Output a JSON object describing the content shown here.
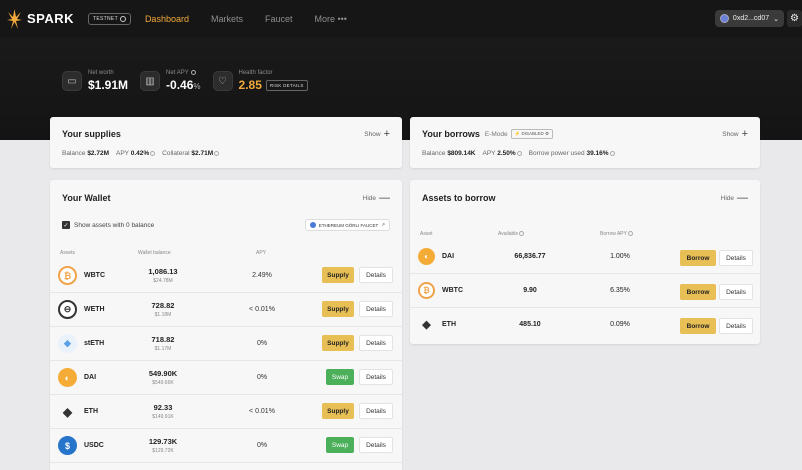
{
  "nav": {
    "logo": "SPARK",
    "testnet_label": "TESTNET",
    "items": [
      {
        "label": "Dashboard",
        "active": true
      },
      {
        "label": "Markets",
        "active": false
      },
      {
        "label": "Faucet",
        "active": false
      },
      {
        "label": "More •••",
        "active": false
      }
    ],
    "wallet_address": "0xd2...cd07"
  },
  "hero": {
    "net_worth_label": "Net worth",
    "net_worth_value": "$1.91M",
    "net_apy_label": "Net APY",
    "net_apy_value": "-0.46",
    "net_apy_unit": "%",
    "health_label": "Health factor",
    "health_value": "2.85",
    "risk_details_label": "RISK DETAILS"
  },
  "supplies": {
    "title": "Your supplies",
    "toggle_label": "Show",
    "balance_label": "Balance",
    "balance_value": "$2.72M",
    "apy_label": "APY",
    "apy_value": "0.42%",
    "collateral_label": "Collateral",
    "collateral_value": "$2.71M"
  },
  "borrows": {
    "title": "Your borrows",
    "emode_label": "E-Mode",
    "emode_badge": "DISABLED",
    "toggle_label": "Show",
    "balance_label": "Balance",
    "balance_value": "$809.14K",
    "apy_label": "APY",
    "apy_value": "2.50%",
    "power_label": "Borrow power used",
    "power_value": "39.16%"
  },
  "wallet": {
    "title": "Your Wallet",
    "toggle_label": "Hide",
    "checkbox_label": "Show assets with 0 balance",
    "faucet_label": "ETHEREUM GÖRLI FAUCET",
    "columns": [
      "Assets",
      "Wallet balance",
      "APY"
    ],
    "rows": [
      {
        "symbol": "WBTC",
        "amount": "1,086.13",
        "usd": "$24.78M",
        "apy": "2.49%",
        "action": "Supply",
        "details": "Details"
      },
      {
        "symbol": "WETH",
        "amount": "728.82",
        "usd": "$1.18M",
        "apy": "< 0.01%",
        "action": "Supply",
        "details": "Details"
      },
      {
        "symbol": "stETH",
        "amount": "718.82",
        "usd": "$1.17M",
        "apy": "0%",
        "action": "Supply",
        "details": "Details"
      },
      {
        "symbol": "DAI",
        "amount": "549.90K",
        "usd": "$549.66K",
        "apy": "0%",
        "action": "Swap",
        "details": "Details"
      },
      {
        "symbol": "ETH",
        "amount": "92.33",
        "usd": "$149.91K",
        "apy": "< 0.01%",
        "action": "Supply",
        "details": "Details"
      },
      {
        "symbol": "USDC",
        "amount": "129.73K",
        "usd": "$129.72K",
        "apy": "0%",
        "action": "Swap",
        "details": "Details"
      }
    ]
  },
  "borrow_assets": {
    "title": "Assets to borrow",
    "toggle_label": "Hide",
    "columns": [
      "Asset",
      "Available",
      "Borrow APY"
    ],
    "rows": [
      {
        "symbol": "DAI",
        "available": "66,836.77",
        "apy": "1.00%",
        "action": "Borrow",
        "details": "Details"
      },
      {
        "symbol": "WBTC",
        "available": "9.90",
        "apy": "6.35%",
        "action": "Borrow",
        "details": "Details"
      },
      {
        "symbol": "ETH",
        "available": "485.10",
        "apy": "0.09%",
        "action": "Borrow",
        "details": "Details"
      }
    ]
  },
  "colors": {
    "accent": "#f2a93b",
    "supply_button": "#e8bf55",
    "swap_button": "#4caf5a"
  }
}
